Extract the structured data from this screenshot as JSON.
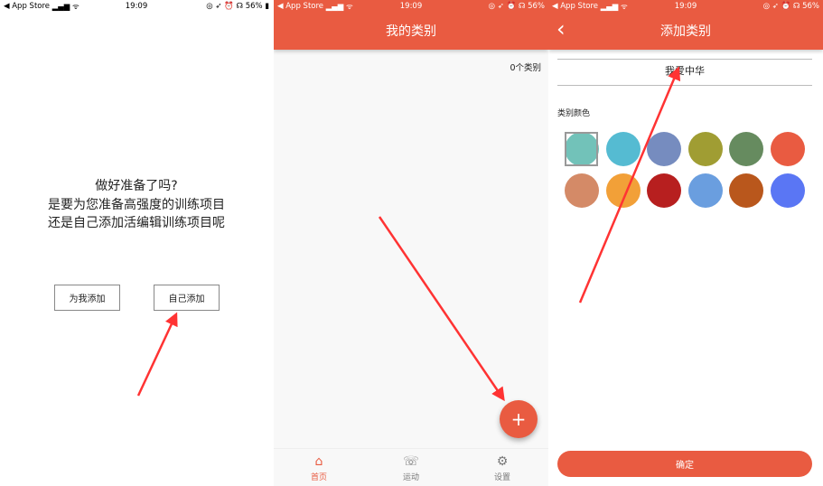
{
  "status": {
    "carrier": "◀ App Store",
    "signal": "▂▄▆ ᯤ",
    "time": "19:09",
    "right": "◎ ➶ ⏰ ☊ 56%"
  },
  "screen1": {
    "question": "做好准备了吗?",
    "line2": "是要为您准备高强度的训练项目",
    "line3": "还是自己添加活编辑训练项目呢",
    "btn_auto": "为我添加",
    "btn_self": "自己添加"
  },
  "screen2": {
    "title": "我的类别",
    "count": "0个类别",
    "fab": "+",
    "nav": [
      {
        "label": "首页",
        "icon": "home-icon",
        "glyph": "⌂"
      },
      {
        "label": "运动",
        "icon": "whistle-icon",
        "glyph": "☏"
      },
      {
        "label": "设置",
        "icon": "gear-icon",
        "glyph": "⚙"
      }
    ]
  },
  "screen3": {
    "back": "‹",
    "title": "添加类别",
    "name_value": "我爱中华",
    "color_label": "类别颜色",
    "colors": [
      "#72c2b9",
      "#55bbd2",
      "#768cbf",
      "#a09d33",
      "#668b5f",
      "#e95b41",
      "#d48a67",
      "#f2a038",
      "#b71f1f",
      "#6a9edf",
      "#b9571c",
      "#5a76f4"
    ],
    "selected_color": 0,
    "confirm": "确定"
  },
  "accent": "#e95b41"
}
